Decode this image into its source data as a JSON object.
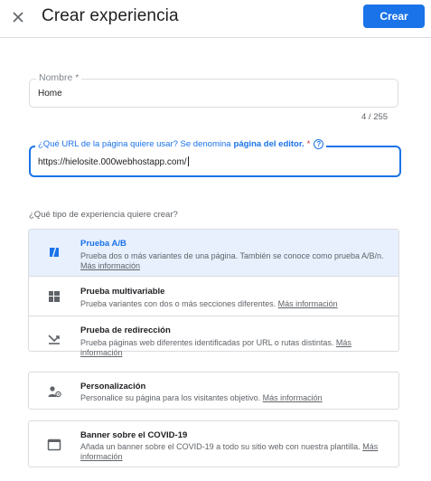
{
  "header": {
    "title": "Crear experiencia",
    "create_label": "Crear"
  },
  "name_field": {
    "label": "Nombre *",
    "value": "Home",
    "counter": "4 / 255"
  },
  "url_field": {
    "label_prefix": "¿Qué URL de la página quiere usar? Se denomina",
    "label_bold": "página del editor.",
    "required_mark": "*",
    "help_glyph": "?",
    "value": "https://hielosite.000webhostapp.com/"
  },
  "experience_question": "¿Qué tipo de experiencia quiere crear?",
  "options": [
    {
      "title": "Prueba A/B",
      "description": "Prueba dos o más variantes de una página. También se conoce como prueba A/B/n.",
      "link": "Más información",
      "icon": "ab-test-icon",
      "selected": true
    },
    {
      "title": "Prueba multivariable",
      "description": "Prueba variantes con dos o más secciones diferentes.",
      "link": "Más información",
      "icon": "multivariate-icon",
      "selected": false
    },
    {
      "title": "Prueba de redirección",
      "description": "Prueba páginas web diferentes identificadas por URL o rutas distintas.",
      "link": "Más información",
      "icon": "redirect-icon",
      "selected": false
    },
    {
      "title": "Personalización",
      "description": "Personalice su página para los visitantes objetivo.",
      "link": "Más información",
      "icon": "personalization-icon",
      "selected": false
    },
    {
      "title": "Banner sobre el COVID-19",
      "description": "Añada un banner sobre el COVID-19 a todo su sitio web con nuestra plantilla.",
      "link": "Más información",
      "icon": "banner-icon",
      "selected": false
    }
  ],
  "colors": {
    "accent": "#1a73e8",
    "selected_bg": "#e8f0fe",
    "required": "#d93025"
  }
}
